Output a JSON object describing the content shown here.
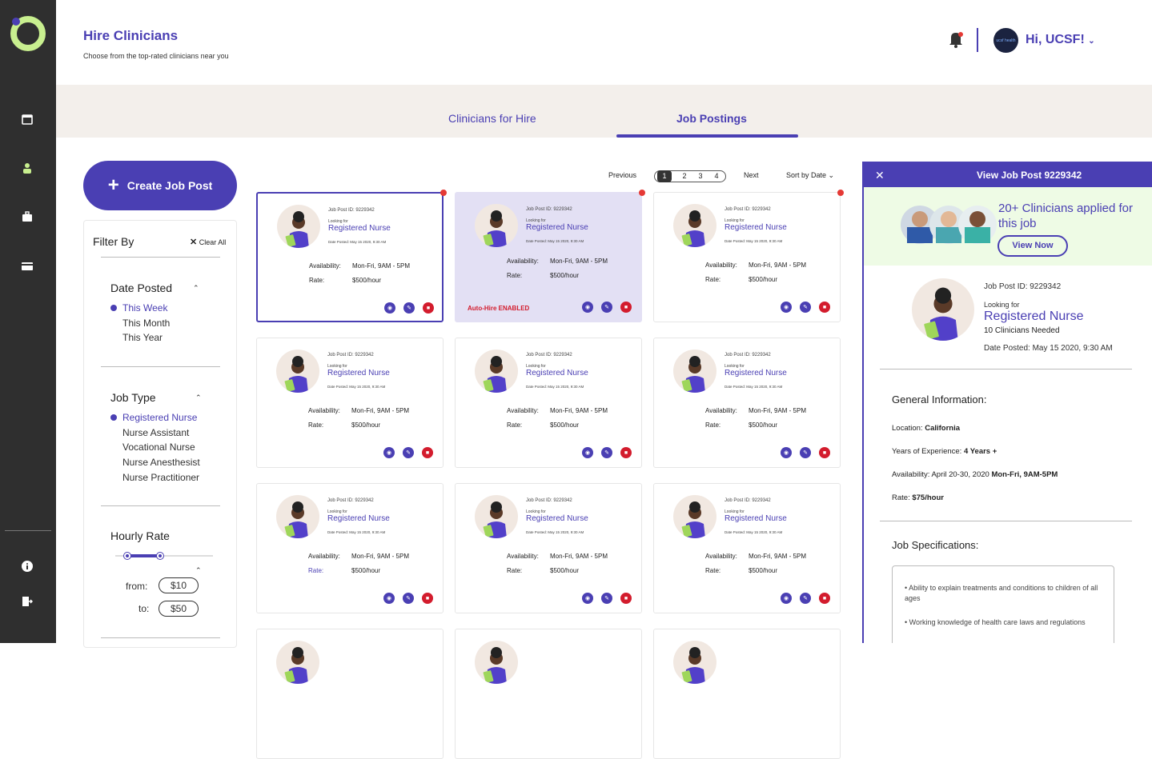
{
  "header": {
    "title": "Hire Clinicians",
    "subtitle": "Choose from the top-rated clinicians near you",
    "greeting": "Hi, UCSF!",
    "avatar_text": "ucsf health"
  },
  "tabs": [
    {
      "label": "Clinicians for Hire"
    },
    {
      "label": "Job Postings"
    }
  ],
  "create_button": {
    "label": "Create Job Post"
  },
  "filter": {
    "title": "Filter By",
    "clear_label": "Clear All",
    "date_posted": {
      "heading": "Date Posted",
      "options": [
        "This Week",
        "This Month",
        "This Year"
      ]
    },
    "job_type": {
      "heading": "Job Type",
      "options": [
        "Registered Nurse",
        "Nurse Assistant",
        "Vocational Nurse",
        "Nurse Anesthesist",
        "Nurse Practitioner"
      ]
    },
    "hourly_rate": {
      "heading": "Hourly Rate",
      "from_label": "from:",
      "from_value": "$10",
      "to_label": "to:",
      "to_value": "$50"
    }
  },
  "pagination": {
    "previous": "Previous",
    "pages": [
      "1",
      "2",
      "3",
      "4"
    ],
    "next": "Next",
    "sort": "Sort by Date"
  },
  "card": {
    "job_id": "Job Post ID: 9229342",
    "looking_for": "Looking for",
    "role": "Registered Nurse",
    "date_posted": "Date Posted: May 15 2020, 9:30 AM",
    "availability_label": "Availability:",
    "availability_value": "Mon-Fri, 9AM - 5PM",
    "rate_label": "Rate:",
    "rate_value": "$500/hour",
    "auto_hire": "Auto-Hire ENABLED"
  },
  "panel": {
    "title": "View Job Post 9229342",
    "promo": "20+ Clinicians applied for this job",
    "view_now": "View Now",
    "job_id": "Job Post ID: 9229342",
    "looking_for": "Looking for",
    "role": "Registered Nurse",
    "needed": "10 Clinicians Needed",
    "date_posted": "Date Posted: May 15 2020, 9:30 AM",
    "general_heading": "General Information:",
    "location_label": "Location:",
    "location_value": "California",
    "experience_label": "Years of Experience:",
    "experience_value": "4 Years +",
    "availability_label": "Availability: April 20-30, 2020",
    "availability_value": "Mon-Fri, 9AM-5PM",
    "rate_label": "Rate:",
    "rate_value": "$75/hour",
    "spec_heading": "Job Specifications:",
    "specs": [
      "• Ability to explain treatments and conditions to children of all ages",
      "• Working knowledge of health care laws and regulations"
    ]
  },
  "colors": {
    "accent": "#4a3fb3",
    "danger": "#d31c2d",
    "sidebar": "#2f2f2f",
    "logo": "#c8ef8f"
  }
}
